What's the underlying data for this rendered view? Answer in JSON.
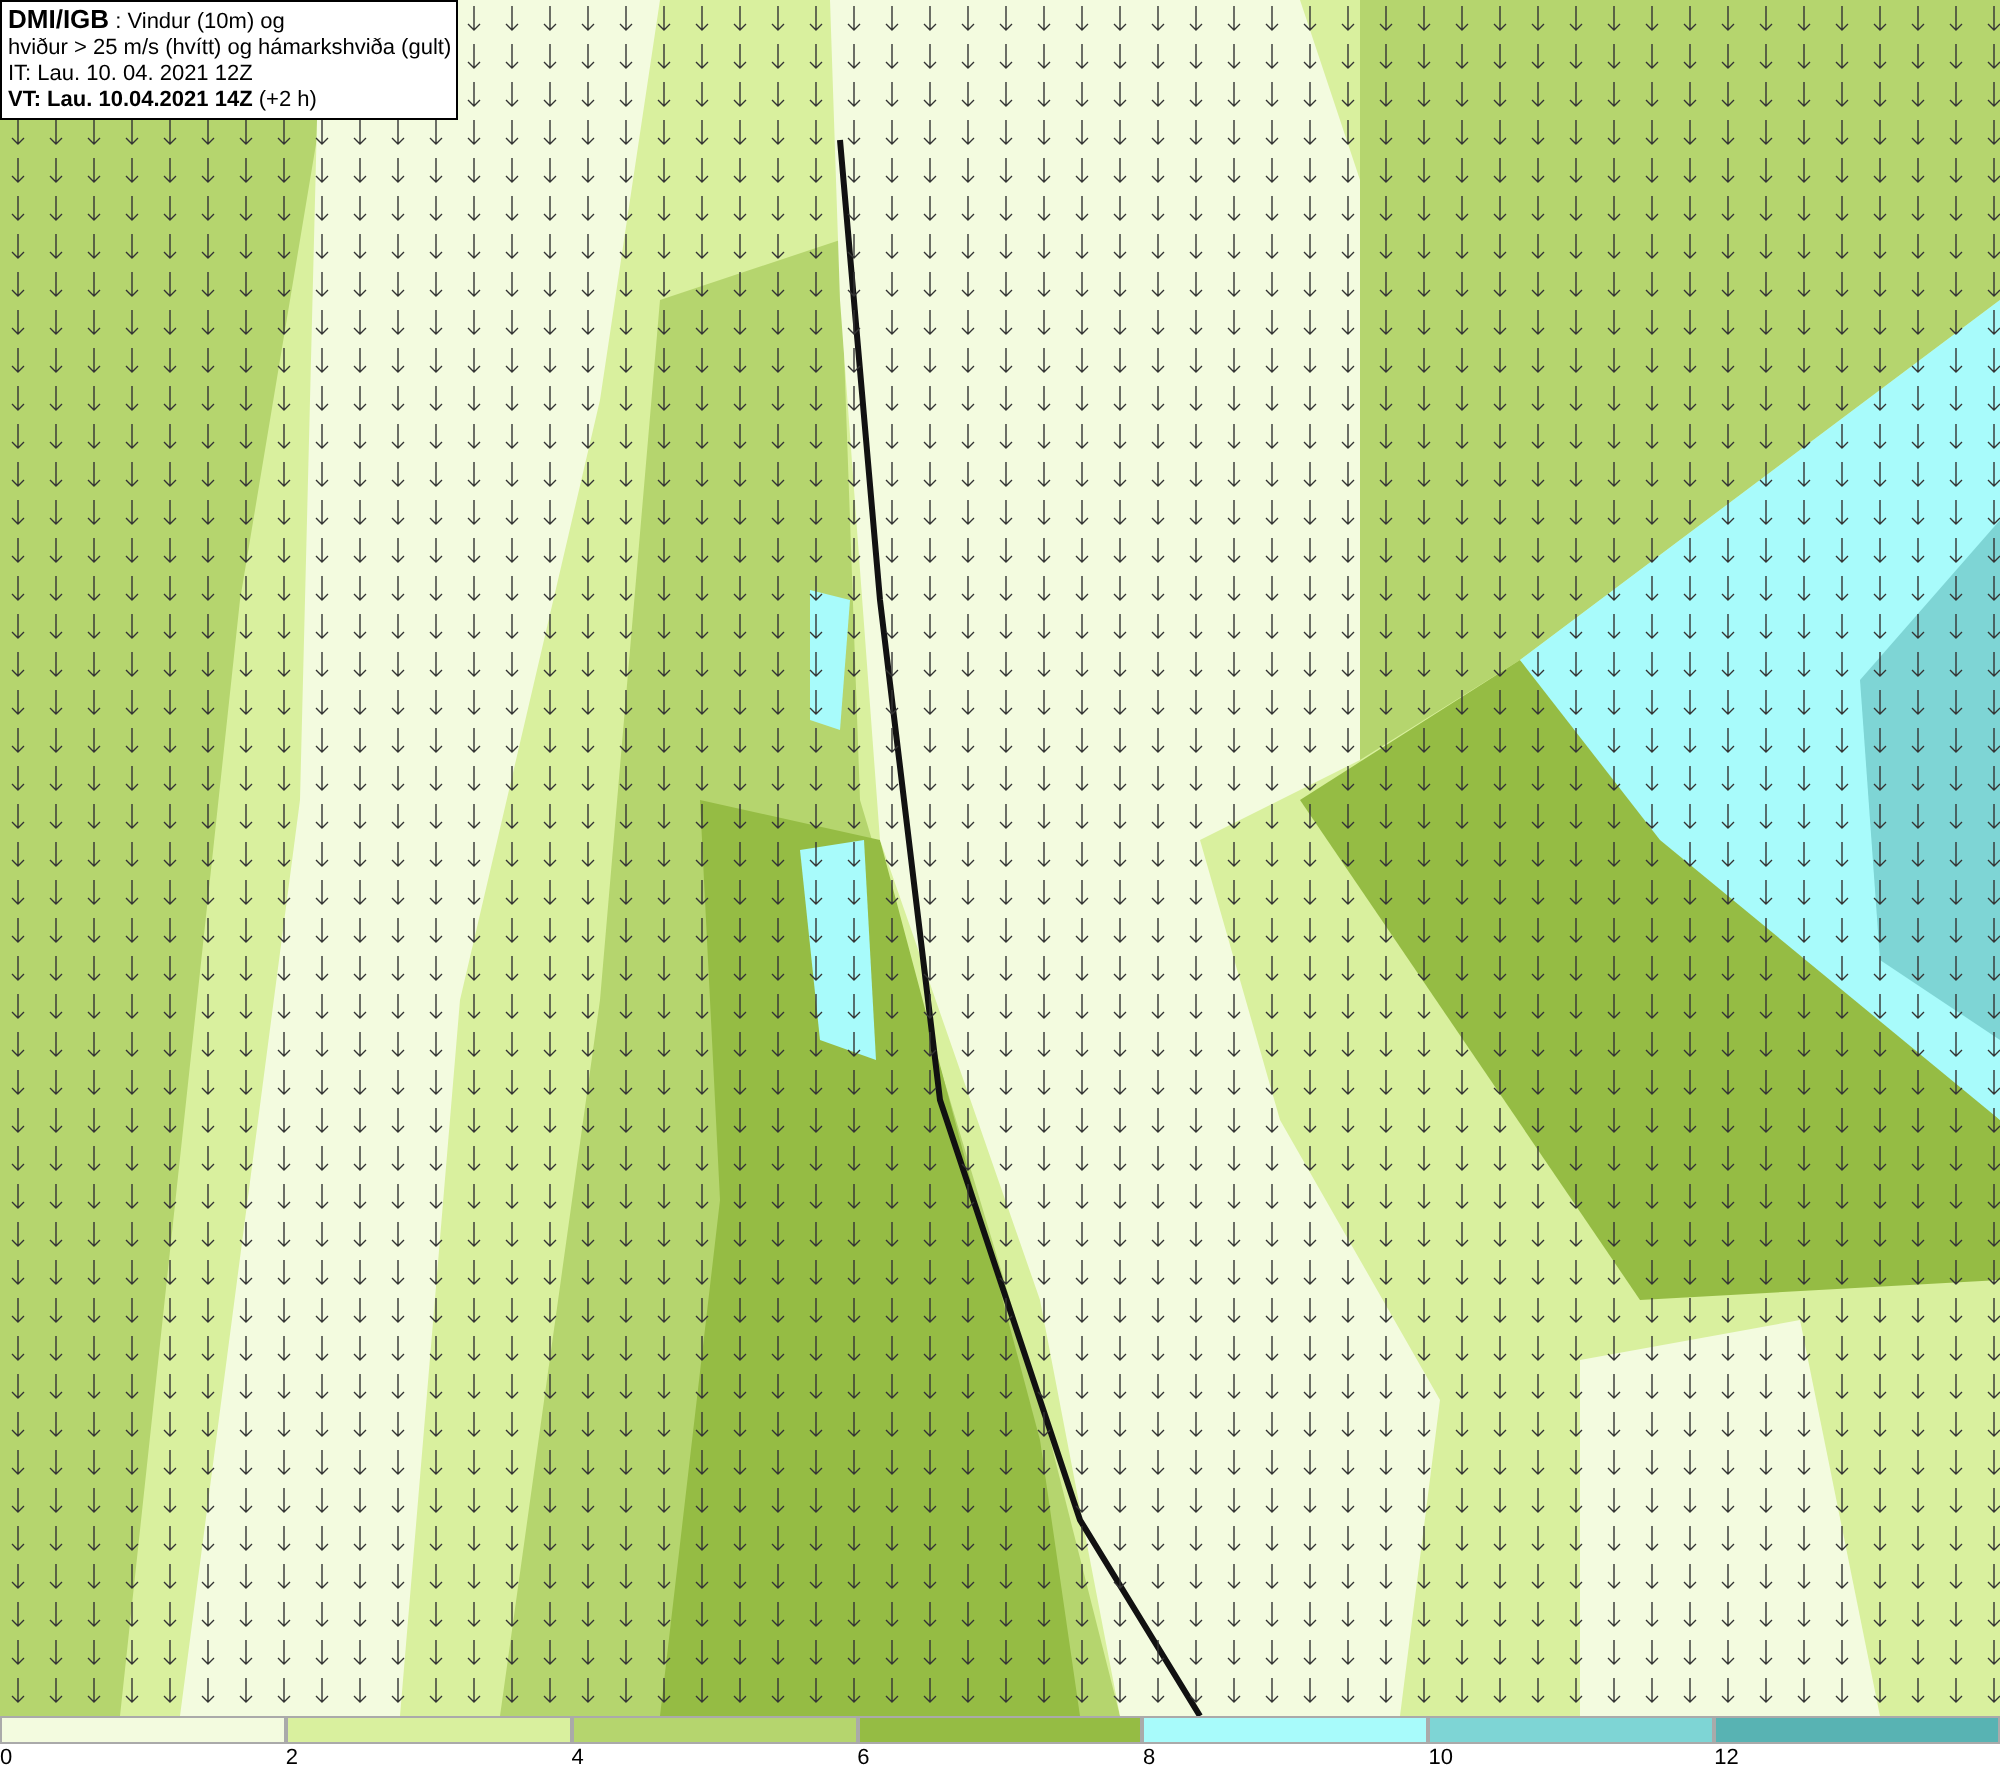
{
  "header": {
    "lines": [
      "**DMI/IGB** : Vindur (10m) og",
      "hviður > 25 m/s (hvítt) og hámarkshviða (gult)",
      "IT: Lau. 10. 04. 2021 12Z",
      "**VT: Lau. 10.04.2021 14Z** (+2 h)"
    ]
  },
  "legend": [
    {
      "label": "0",
      "color": "#f3fbdf"
    },
    {
      "label": "2",
      "color": "#d9f09e"
    },
    {
      "label": "4",
      "color": "#b5d56e"
    },
    {
      "label": "6",
      "color": "#95bc44"
    },
    {
      "label": "8",
      "color": "#a8fbfb"
    },
    {
      "label": "10",
      "color": "#7ed5d5"
    },
    {
      "label": "12",
      "color": "#58b3b3"
    }
  ]
}
